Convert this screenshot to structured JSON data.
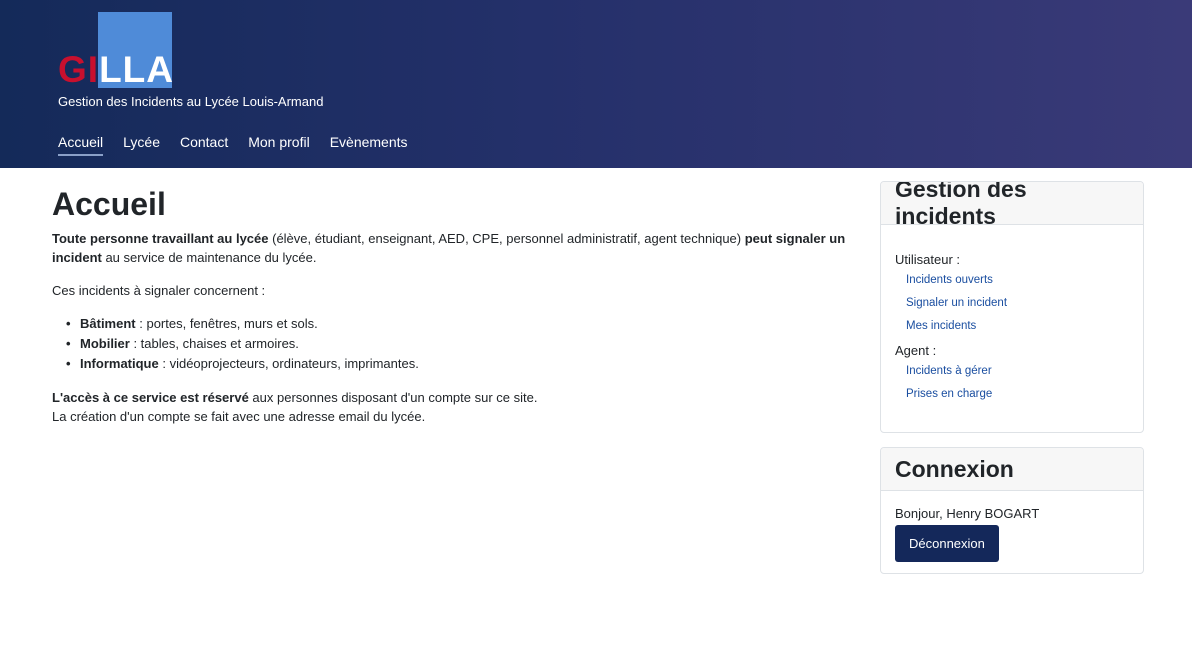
{
  "header": {
    "logo_part1": "GI",
    "logo_part2": "LLA",
    "subtitle": "Gestion des Incidents au Lycée Louis-Armand",
    "nav": [
      {
        "label": "Accueil"
      },
      {
        "label": "Lycée"
      },
      {
        "label": "Contact"
      },
      {
        "label": "Mon profil"
      },
      {
        "label": "Evènements"
      }
    ]
  },
  "main": {
    "title": "Accueil",
    "intro": {
      "b1": "Toute personne travaillant au lycée",
      "t1": " (élève, étudiant, enseignant, AED, CPE, personnel administratif, agent technique) ",
      "b2": "peut signaler un incident",
      "t2": " au service de maintenance du lycée."
    },
    "concern": "Ces incidents à signaler concernent :",
    "items": [
      {
        "name": "Bâtiment",
        "desc": " : portes, fenêtres, murs et sols."
      },
      {
        "name": "Mobilier",
        "desc": " : tables, chaises et armoires."
      },
      {
        "name": "Informatique",
        "desc": " : vidéoprojecteurs, ordinateurs, imprimantes."
      }
    ],
    "access": {
      "b": "L'accès à ce service est réservé",
      "t": " aux personnes disposant d'un compte sur ce site.",
      "line2": "La création d'un compte se fait avec une adresse email du lycée."
    }
  },
  "sidebar": {
    "incidents": {
      "title": "Gestion des incidents",
      "user_label": "Utilisateur :",
      "user_links": [
        "Incidents ouverts",
        "Signaler un incident",
        "Mes incidents"
      ],
      "agent_label": "Agent :",
      "agent_links": [
        "Incidents à gérer",
        "Prises en charge"
      ]
    },
    "login": {
      "title": "Connexion",
      "greeting": "Bonjour, Henry BOGART",
      "logout": "Déconnexion"
    }
  },
  "colors": {
    "header_start": "#142a59",
    "header_end": "#3a3a78",
    "logo_red": "#c8102e",
    "logo_blue": "#4f8bd8",
    "link": "#1a4ea0",
    "button": "#14285a"
  }
}
